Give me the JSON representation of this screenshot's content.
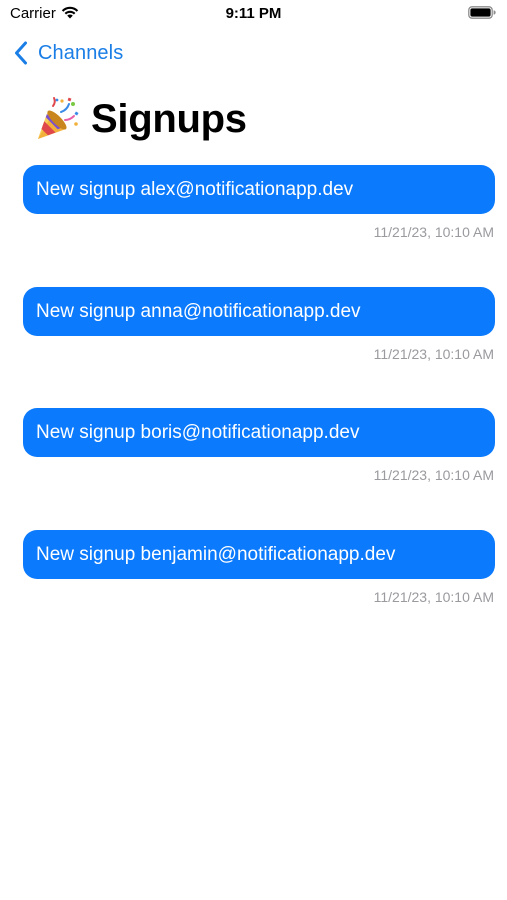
{
  "status_bar": {
    "carrier": "Carrier",
    "time": "9:11 PM"
  },
  "nav": {
    "back_label": "Channels",
    "back_icon": "chevron-left-icon"
  },
  "title": {
    "icon": "party-popper-icon",
    "text": "Signups"
  },
  "colors": {
    "accent": "#1a7ee6",
    "bubble": "#0b7afd",
    "timestamp": "#9a9a9f"
  },
  "messages": [
    {
      "text": "New signup alex@notificationapp.dev",
      "timestamp": "11/21/23, 10:10 AM"
    },
    {
      "text": "New signup anna@notificationapp.dev",
      "timestamp": "11/21/23, 10:10 AM"
    },
    {
      "text": "New signup boris@notificationapp.dev",
      "timestamp": "11/21/23, 10:10 AM"
    },
    {
      "text": "New signup benjamin@notificationapp.dev",
      "timestamp": "11/21/23, 10:10 AM"
    }
  ]
}
